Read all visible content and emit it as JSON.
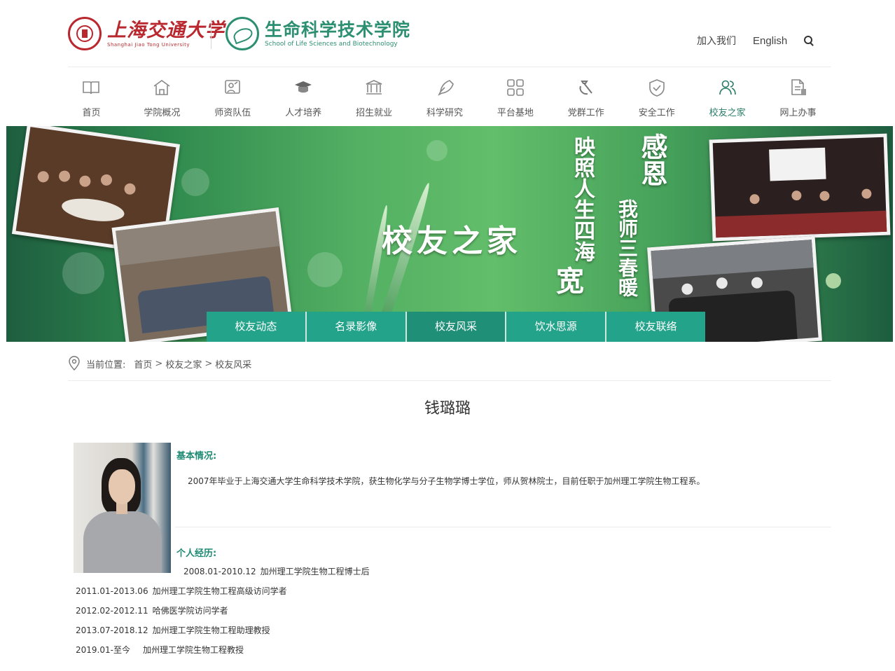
{
  "header": {
    "sjtu_name": "上海交通大学",
    "sjtu_en": "Shanghai Jiao Tong University",
    "school_name": "生命科学技术学院",
    "school_en": "School of Life Sciences and Biotechnology",
    "join_label": "加入我们",
    "english_label": "English",
    "search_icon": "search-icon"
  },
  "nav": {
    "items": [
      {
        "label": "首页",
        "icon": "book-icon"
      },
      {
        "label": "学院概况",
        "icon": "building-icon"
      },
      {
        "label": "师资队伍",
        "icon": "teacher-icon"
      },
      {
        "label": "人才培养",
        "icon": "graduation-cap-icon"
      },
      {
        "label": "招生就业",
        "icon": "institution-icon"
      },
      {
        "label": "科学研究",
        "icon": "pen-icon"
      },
      {
        "label": "平台基地",
        "icon": "grid-icon"
      },
      {
        "label": "党群工作",
        "icon": "hammer-sickle-icon"
      },
      {
        "label": "安全工作",
        "icon": "shield-icon"
      },
      {
        "label": "校友之家",
        "icon": "users-icon"
      },
      {
        "label": "网上办事",
        "icon": "document-icon"
      }
    ],
    "active_index": 9,
    "active_color": "#2a7d6a"
  },
  "banner": {
    "title": "校友之家",
    "vertical_1": "映照人生四海",
    "vertical_2": "宽",
    "vertical_3": "感恩",
    "vertical_4": "我师三春暖",
    "subnav": [
      "校友动态",
      "名录影像",
      "校友风采",
      "饮水思源",
      "校友联络"
    ],
    "subnav_active_index": 2,
    "accent": "#23a38a"
  },
  "breadcrumb": {
    "prefix": "当前位置:",
    "items": [
      "首页",
      "校友之家",
      "校友风采"
    ],
    "separator": ">"
  },
  "article": {
    "title": "钱璐璐",
    "basic_heading": "基本情况:",
    "basic_text": "2007年毕业于上海交通大学生命科学技术学院，获生物化学与分子生物学博士学位，师从贺林院士，目前任职于加州理工学院生物工程系。",
    "cv_heading": "个人经历:",
    "cv": [
      {
        "date": "2008.01-2010.12",
        "role": "加州理工学院生物工程博士后"
      },
      {
        "date": "2011.01-2013.06",
        "role": "加州理工学院生物工程高级访问学者"
      },
      {
        "date": "2012.02-2012.11",
        "role": "哈佛医学院访问学者"
      },
      {
        "date": "2013.07-2018.12",
        "role": "加州理工学院生物工程助理教授"
      },
      {
        "date": "2019.01-至今",
        "role": "加州理工学院生物工程教授"
      }
    ]
  }
}
